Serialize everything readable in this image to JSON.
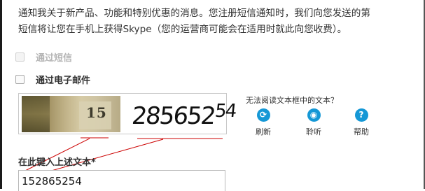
{
  "intro": {
    "line1": "通知我关于新产品、功能和特别优惠的消息。您注册短信通知时，我们向您发送的第",
    "line2": "短信将让您在手机上获得Skype（您的运营商可能会在适用时就此向您收费）。"
  },
  "options": {
    "sms_label": "通过短信",
    "email_label": "通过电子邮件"
  },
  "captcha": {
    "photo_text": "15",
    "word_main": "285652",
    "word_sup": "54",
    "cant_read": "无法阅读文本框中的文本？",
    "refresh_label": "刷新",
    "listen_label": "聆听",
    "help_label": "帮助",
    "refresh_glyph": "⟳",
    "listen_glyph": "◉",
    "help_glyph": "?",
    "input_label": "在此键入上述文本",
    "required_mark": "*",
    "input_value": "152865254"
  },
  "colors": {
    "accent_blue": "#1598d6",
    "annotation_red": "#cc0000"
  },
  "icons": {
    "refresh": "refresh-icon",
    "listen": "listen-icon",
    "help": "help-icon"
  }
}
